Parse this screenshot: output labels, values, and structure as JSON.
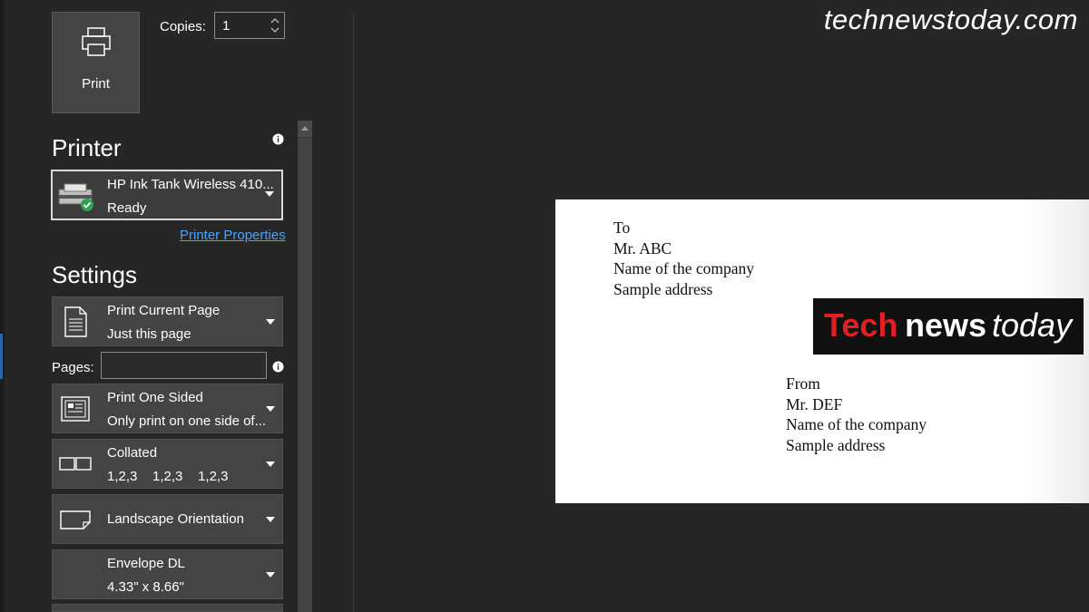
{
  "watermark": "technewstoday.com",
  "print_button": {
    "label": "Print",
    "icon": "printer-icon"
  },
  "copies": {
    "label": "Copies:",
    "value": "1"
  },
  "printer": {
    "section_title": "Printer",
    "name": "HP Ink Tank Wireless 410...",
    "status": "Ready",
    "properties_link": "Printer Properties"
  },
  "settings": {
    "section_title": "Settings",
    "print_range": {
      "title": "Print Current Page",
      "subtitle": "Just this page",
      "icon": "page-icon"
    },
    "pages_label": "Pages:",
    "pages_value": "",
    "sides": {
      "title": "Print One Sided",
      "subtitle": "Only print on one side of...",
      "icon": "one-sided-icon"
    },
    "collation": {
      "title": "Collated",
      "subtitle": "1,2,3    1,2,3    1,2,3",
      "icon": "collated-icon"
    },
    "orientation": {
      "title": "Landscape Orientation",
      "icon": "landscape-icon"
    },
    "paper_size": {
      "title": "Envelope DL",
      "subtitle": "4.33\" x 8.66\""
    }
  },
  "preview": {
    "to_lines": [
      "To",
      "Mr. ABC",
      "Name of the company",
      "Sample address"
    ],
    "logo": {
      "part1": "Tech",
      "part2": "news",
      "part3": "today"
    },
    "from_lines": [
      "From",
      "Mr. DEF",
      "Name of the company",
      "Sample address"
    ]
  },
  "colors": {
    "accent_link": "#4aa3ff",
    "logo_red": "#e31e24",
    "status_green": "#2ea44f"
  }
}
